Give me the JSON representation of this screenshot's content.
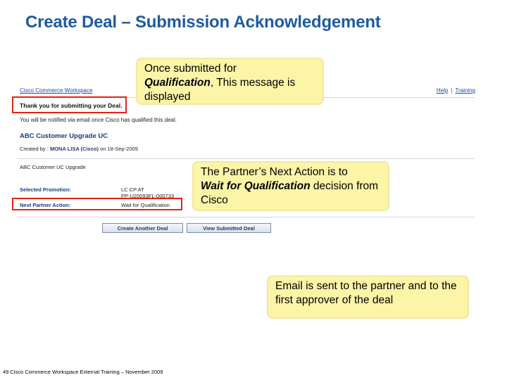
{
  "slide": {
    "title": "Create Deal – Submission Acknowledgement",
    "footer": "49 Cisco Commerce Workspace External Training – November 2009"
  },
  "app": {
    "name": "Cisco Commerce Workspace",
    "links": {
      "help": "Help",
      "separator": "|",
      "training": "Training"
    }
  },
  "page": {
    "thank_you": "Thank you for submitting your Deal.",
    "notify_message": "You will be notified via email once Cisco has qualified this deal.",
    "deal_name": "ABC Customer Upgrade UC",
    "created_by_label": "Created by :",
    "created_by_name": "MONA LISA (Cisco)",
    "created_on": "on 18-Sep-2009",
    "deal_description": "ABC Customer UC Upgrade",
    "fields": [
      {
        "label": "Selected Promotion:",
        "value_line1": "LC CP AT",
        "value_line2": "PP-U20093FL-000733"
      },
      {
        "label": "Next Partner Action:",
        "value_line1": "Wait for Qualification",
        "value_line2": ""
      }
    ],
    "buttons": {
      "create_another": "Create Another Deal",
      "view_submitted": "View Submitted Deal"
    }
  },
  "callouts": {
    "c1_pre": "Once submitted for",
    "c1_em": "Qualification",
    "c1_post": ", This message is displayed",
    "c2_pre": "The Partner’s Next Action is to",
    "c2_em": "Wait for Qualification",
    "c2_post": " decision from Cisco",
    "c3": "Email is sent to the partner and to the first approver of the deal"
  }
}
